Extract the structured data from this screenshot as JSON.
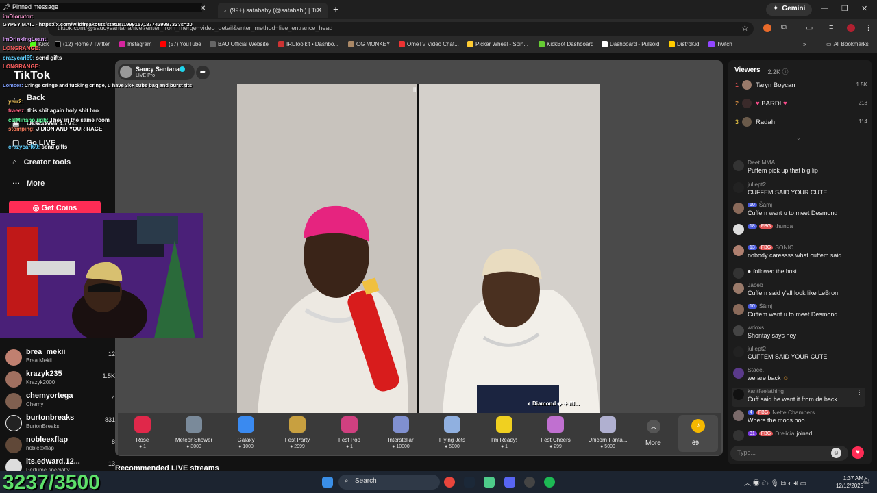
{
  "browser": {
    "tabs": [
      {
        "label": "(99+) satababy (@satababi) | Ti"
      }
    ],
    "new_tab": "+",
    "gemini": "Gemini",
    "url": "tiktok.com/@saucysantana/live?enter_from_merge=video_detail&enter_method=live_entrance_head",
    "bookmarks": [
      "(12) Home / Twitter",
      "Instagram",
      "(57) YouTube",
      "BAU Official Website",
      "IRLToolkit • Dashbo...",
      "OG MONKEY",
      "OmeTV Video Chat...",
      "Picker Wheel - Spin...",
      "KickBot Dashboard",
      "Dashboard - Pulsoid",
      "DistroKid",
      "Twitch"
    ],
    "all_bookmarks": "All Bookmarks",
    "kick": "Kick"
  },
  "sidebar": {
    "logo": "TikTok",
    "nav": [
      "Back",
      "Discover LIVE",
      "Go LIVE",
      "Creator tools",
      "More"
    ],
    "get_coins": "Get Coins",
    "accounts": [
      {
        "name": "brea_mekii",
        "sub": "Brea Mekii",
        "count": "12"
      },
      {
        "name": "krazyk235",
        "sub": "Krazyk2000",
        "count": "1.5K"
      },
      {
        "name": "chemyortega",
        "sub": "Chemy",
        "count": "4"
      },
      {
        "name": "burtonbreaks",
        "sub": "BurtonBreaks",
        "count": "831"
      },
      {
        "name": "nobleexflap",
        "sub": "nobleexflap",
        "count": "8"
      },
      {
        "name": "its.edward.12...",
        "sub": "Perfume specialty",
        "count": "13"
      }
    ]
  },
  "stream": {
    "streamer": "Saucy Santana",
    "badge": "LIVE Pro",
    "overlay_label": "Diamond",
    "overlay_suffix": "/N...",
    "more_label": "More",
    "coin_count": "69",
    "recommended": "Recommended LIVE streams"
  },
  "gifts": [
    {
      "name": "Rose",
      "price": "1"
    },
    {
      "name": "Meteor Shower",
      "price": "3000"
    },
    {
      "name": "Galaxy",
      "price": "1000"
    },
    {
      "name": "Fest Party",
      "price": "2999"
    },
    {
      "name": "Fest Pop",
      "price": "1"
    },
    {
      "name": "Interstellar",
      "price": "10000"
    },
    {
      "name": "Flying Jets",
      "price": "5000"
    },
    {
      "name": "I'm Ready!",
      "price": "1"
    },
    {
      "name": "Fest Cheers",
      "price": "299"
    },
    {
      "name": "Unicorn Fanta...",
      "price": "5000"
    }
  ],
  "viewers": {
    "title": "Viewers",
    "count": "2.2K",
    "list": [
      {
        "rank": "1",
        "name": "Taryn Boycan",
        "score": "1.5K"
      },
      {
        "rank": "2",
        "name": "BARDI",
        "score": "218"
      },
      {
        "rank": "3",
        "name": "Radah",
        "score": "114"
      }
    ]
  },
  "chat": [
    {
      "user": "Deet MMA",
      "msg": "Puffem pick up that big lip",
      "lvl": "",
      "fbg": ""
    },
    {
      "user": "juliept2",
      "msg": "CUFFEM SAID YOUR CUTE",
      "lvl": "",
      "fbg": ""
    },
    {
      "user": "Šămj",
      "msg": "Cuffem want u to meet Desmond",
      "lvl": "10",
      "fbg": ""
    },
    {
      "user": "thunda___",
      "msg": ".",
      "lvl": "18",
      "fbg": "FBG"
    },
    {
      "user": "SONIC.",
      "msg": "nobody caressss what cuffem said",
      "lvl": "13",
      "fbg": "FBG"
    },
    {
      "user": "",
      "msg": "followed the host",
      "lvl": "",
      "fbg": ""
    },
    {
      "user": "Jaceb",
      "msg": "Cuffem said y'all look like LeBron",
      "lvl": "",
      "fbg": ""
    },
    {
      "user": "Šămj",
      "msg": "Cuffem want u to meet Desmond",
      "lvl": "10",
      "fbg": ""
    },
    {
      "user": "wdoxs",
      "msg": "Shontay says hey",
      "lvl": "",
      "fbg": ""
    },
    {
      "user": "juliept2",
      "msg": "CUFFEM SAID YOUR CUTE",
      "lvl": "",
      "fbg": ""
    },
    {
      "user": "Stace.",
      "msg": "we are back",
      "lvl": "",
      "fbg": ""
    },
    {
      "user": "kantfeelathing",
      "msg": "Cuff said he want it from da back",
      "lvl": "",
      "fbg": ""
    },
    {
      "user": "Nette Chambers",
      "msg": "Where the mods boo",
      "lvl": "4",
      "fbg": "FBG"
    },
    {
      "user": "Drelicia",
      "msg": "joined",
      "lvl": "31",
      "fbg": "FBG"
    }
  ],
  "type_placeholder": "Type...",
  "overlay": {
    "pinned": "Pinned message",
    "pinned_user": "imDlonator:",
    "pinned_text": "GYPSY MAIL - https://x.com/wildfreakouts/status/1999157187742998732?s=20",
    "lines": [
      {
        "user": "imDrinkingLeant:",
        "msg": "",
        "color": "#e0a0ff"
      },
      {
        "user": "LONGRANGE:",
        "msg": "",
        "color": "#ff6060"
      },
      {
        "user": "crazycarl69:",
        "msg": "send gifts",
        "color": "#60d0ff"
      },
      {
        "user": "LONGRANGE:",
        "msg": "",
        "color": "#ff6060"
      },
      {
        "user": "Lomcer:",
        "msg": "Cringe cringe and fucking cringe, u have 3k+ subs bag and burst tits",
        "color": "#80a0ff"
      },
      {
        "user": "yerr2:",
        "msg": "",
        "color": "#ffd060"
      },
      {
        "user": "traeez:",
        "msg": "this shit again holy shit bro",
        "color": "#ff6080"
      },
      {
        "user": "celMinaho ugh:",
        "msg": "They in the same room",
        "color": "#60ffa0"
      },
      {
        "user": "stomping:",
        "msg": "JIDION AND YOUR RAGE",
        "color": "#ff8060"
      },
      {
        "user": "crazycarl69:",
        "msg": "send gifts",
        "color": "#60d0ff"
      }
    ],
    "counter": "3237/3500"
  },
  "taskbar": {
    "search": "Search",
    "time": "1:37 AM",
    "date": "12/12/2025"
  }
}
